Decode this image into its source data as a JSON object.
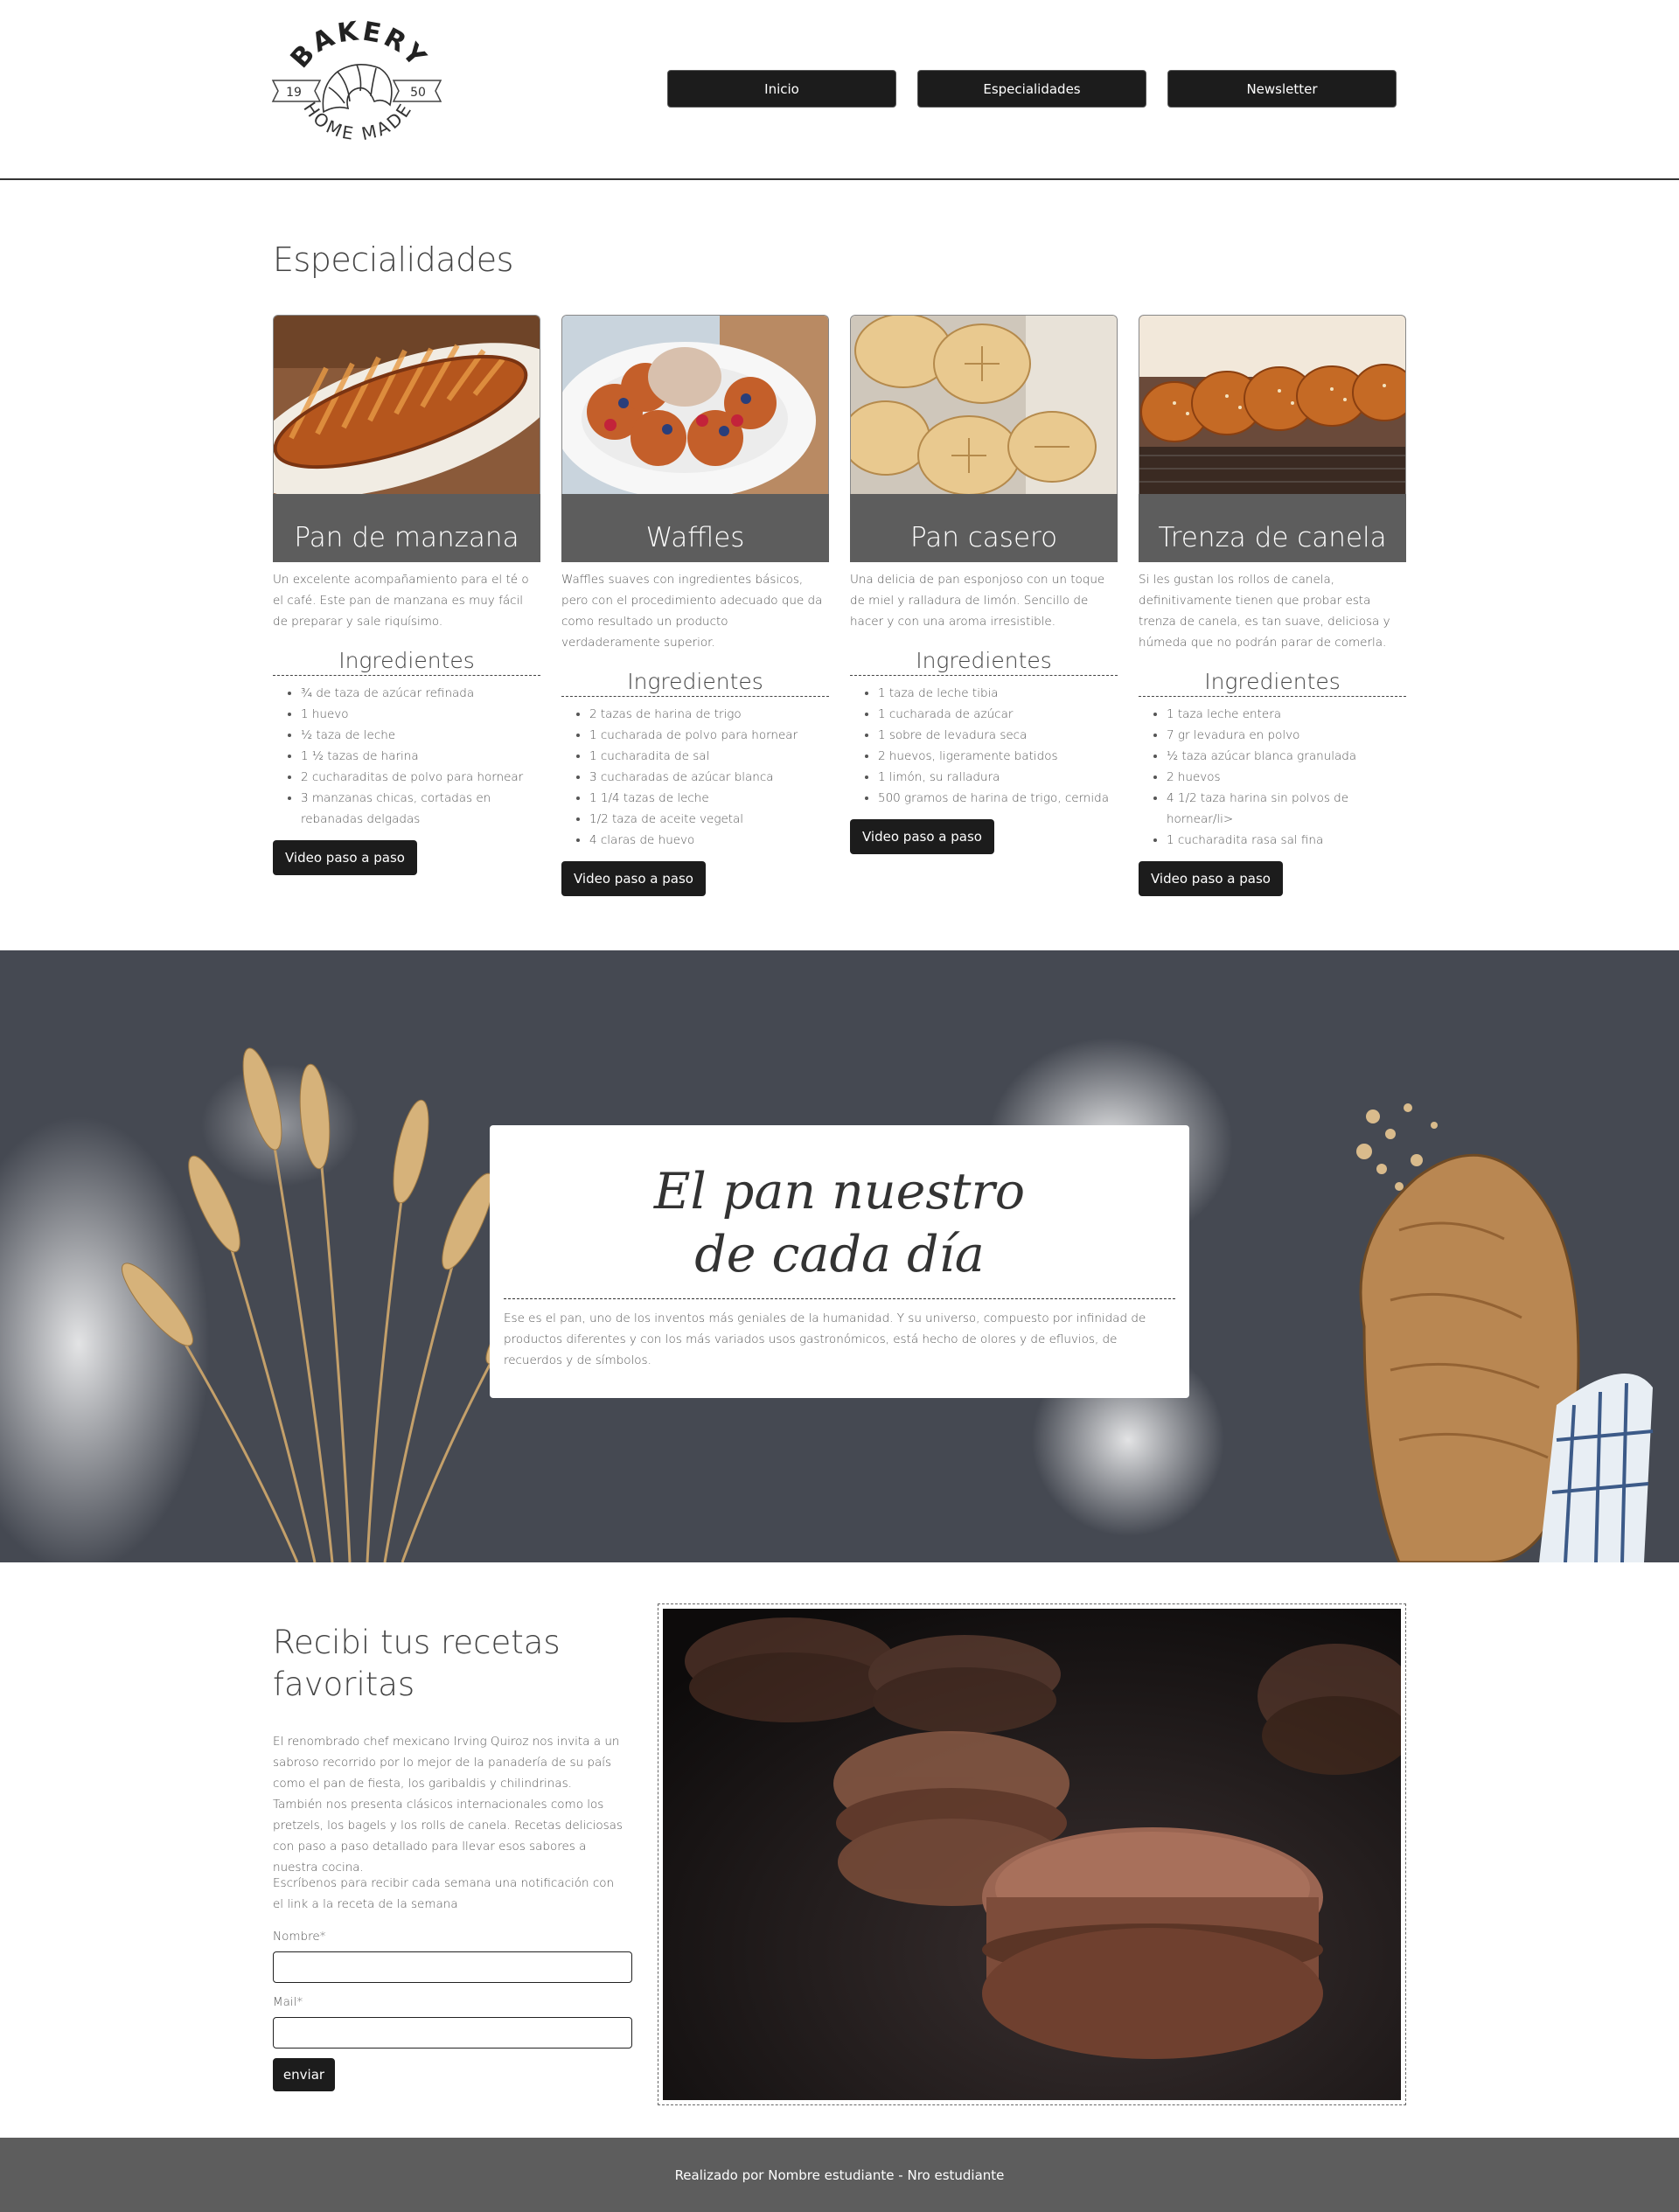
{
  "logo": {
    "top_text": "BAKERY",
    "bottom_text": "HOME MADE",
    "year_left": "19",
    "year_right": "50"
  },
  "nav": {
    "items": [
      "Inicio",
      "Especialidades",
      "Newsletter"
    ]
  },
  "specialties": {
    "title": "Especialidades",
    "ingredients_label": "Ingredientes",
    "button_label": "Video paso a paso",
    "cards": [
      {
        "name": "Pan de manzana",
        "image_icon": "apple-bread-image",
        "description": "Un excelente acompañamiento para el té o el café. Este pan de manzana es muy fácil de preparar y sale riquísimo.",
        "ingredients": [
          "¾ de taza de azúcar refinada",
          "1 huevo",
          "½ taza de leche",
          "1 ½ tazas de harina",
          "2 cucharaditas de polvo para hornear",
          "3 manzanas chicas, cortadas en rebanadas delgadas"
        ]
      },
      {
        "name": "Waffles",
        "image_icon": "waffles-image",
        "description": "Waffles suaves con ingredientes básicos, pero con el procedimiento adecuado que da como resultado un producto verdaderamente superior.",
        "ingredients": [
          "2 tazas de harina de trigo",
          "1 cucharada de polvo para hornear",
          "1 cucharadita de sal",
          "3 cucharadas de azúcar blanca",
          "1 1/4 tazas de leche",
          "1/2 taza de aceite vegetal",
          "4 claras de huevo"
        ]
      },
      {
        "name": "Pan casero",
        "image_icon": "bread-rolls-image",
        "description": "Una delicia de pan esponjoso con un toque de miel y ralladura de limón. Sencillo de hacer y con una aroma irresistible.",
        "ingredients": [
          "1 taza de leche tibia",
          "1 cucharada de azúcar",
          "1 sobre de levadura seca",
          "2 huevos, ligeramente batidos",
          "1 limón, su ralladura",
          "500 gramos de harina de trigo, cernida"
        ]
      },
      {
        "name": "Trenza de canela",
        "image_icon": "braided-bread-image",
        "description": "Si les gustan los rollos de canela, definitivamente tienen que probar esta trenza de canela, es tan suave, deliciosa y húmeda que no podrán parar de comerla.",
        "ingredients": [
          "1 taza leche entera",
          "7 gr levadura en polvo",
          "½ taza azúcar blanca granulada",
          "2 huevos",
          "4 1/2 taza harina sin polvos de hornear/li>",
          "1 cucharadita rasa sal fina"
        ]
      }
    ]
  },
  "banner": {
    "title_line1": "El pan nuestro",
    "title_line2": "de cada día",
    "text": "Ese es el pan, uno de los inventos más geniales de la humanidad. Y su universo, compuesto por infinidad de productos diferentes y con los más variados usos gastronómicos, está hecho de olores y de efluvios, de recuerdos y de símbolos."
  },
  "subscribe": {
    "title": "Recibi tus recetas favoritas",
    "paragraph1": "El renombrado chef mexicano Irving Quiroz nos invita a un sabroso recorrido por lo mejor de la panadería de su país como el pan de fiesta, los garibaldis y chilindrinas. También nos presenta clásicos internacionales como los pretzels, los bagels y los rolls de canela. Recetas deliciosas con paso a paso detallado para llevar esos sabores a nuestra cocina.",
    "paragraph2": "Escríbenos para recibir cada semana una notificación con el link a la receta de la semana",
    "name_label": "Nombre*",
    "name_value": "",
    "mail_label": "Mail*",
    "mail_value": "",
    "submit_label": "enviar"
  },
  "footer": {
    "text": "Realizado por Nombre estudiante - Nro estudiante"
  }
}
